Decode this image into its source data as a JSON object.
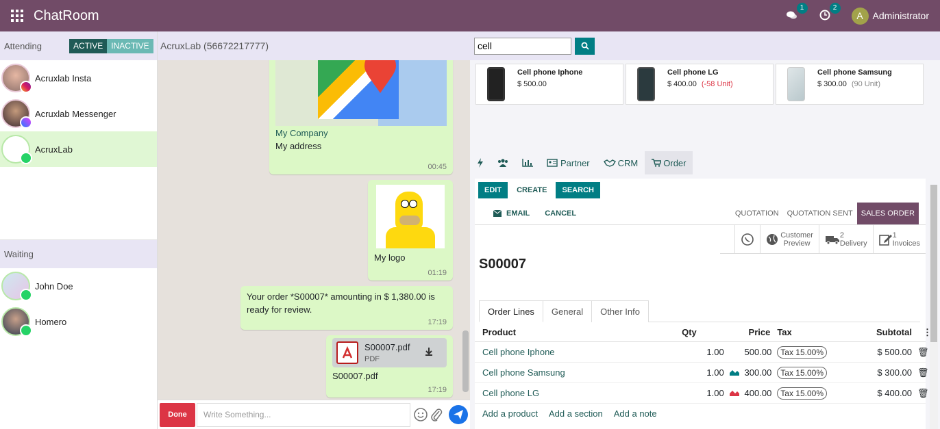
{
  "app": {
    "title": "ChatRoom",
    "user": "Administrator",
    "user_initial": "A",
    "badges": {
      "messages": "1",
      "activities": "2"
    }
  },
  "left": {
    "attending_label": "Attending",
    "toggle": {
      "active": "ACTIVE",
      "inactive": "INACTIVE"
    },
    "conversations": [
      {
        "name": "Acruxlab Insta",
        "channel": "instagram-icon"
      },
      {
        "name": "Acruxlab Messenger",
        "channel": "messenger-icon"
      },
      {
        "name": "AcruxLab",
        "channel": "whatsapp-icon"
      }
    ],
    "waiting_label": "Waiting",
    "waiting": [
      {
        "name": "John Doe",
        "channel": "whatsapp-icon"
      },
      {
        "name": "Homero",
        "channel": "whatsapp-icon"
      }
    ]
  },
  "chat": {
    "header": "AcruxLab (56672217777)",
    "messages": [
      {
        "link": "My Company",
        "text": "My address",
        "time": "00:45"
      },
      {
        "text": "My logo",
        "time": "01:19"
      },
      {
        "text": "Your order *S00007* amounting in $ 1,380.00 is ready for review.",
        "time": "17:19"
      },
      {
        "file_name": "S00007.pdf",
        "file_type": "PDF",
        "text": "S00007.pdf",
        "time": "17:19"
      }
    ],
    "done_label": "Done",
    "input_placeholder": "Write Something..."
  },
  "right": {
    "search_value": "cell",
    "products": [
      {
        "name": "Cell phone Iphone",
        "price": "$ 500.00",
        "stock": ""
      },
      {
        "name": "Cell phone LG",
        "price": "$ 400.00",
        "stock": "(-58 Unit)"
      },
      {
        "name": "Cell phone Samsung",
        "price": "$ 300.00",
        "stock": "(90 Unit)"
      }
    ],
    "tabs": {
      "partner": "Partner",
      "crm": "CRM",
      "order": "Order"
    },
    "buttons": {
      "edit": "EDIT",
      "create": "CREATE",
      "search": "SEARCH",
      "email": "EMAIL",
      "cancel": "CANCEL"
    },
    "stages": [
      "QUOTATION",
      "QUOTATION SENT",
      "SALES ORDER"
    ],
    "smart": {
      "customer_preview_1": "Customer",
      "customer_preview_2": "Preview",
      "delivery_count": "2",
      "delivery": "Delivery",
      "invoices_count": "1",
      "invoices": "Invoices"
    },
    "order_name": "S00007",
    "notebook": [
      "Order Lines",
      "General",
      "Other Info"
    ],
    "columns": {
      "product": "Product",
      "qty": "Qty",
      "price": "Price",
      "tax": "Tax",
      "subtotal": "Subtotal"
    },
    "lines": [
      {
        "product": "Cell phone Iphone",
        "qty": "1.00",
        "price": "500.00",
        "tax": "Tax 15.00%",
        "subtotal": "$ 500.00",
        "forecast": "none"
      },
      {
        "product": "Cell phone Samsung",
        "qty": "1.00",
        "price": "300.00",
        "tax": "Tax 15.00%",
        "subtotal": "$ 300.00",
        "forecast": "available"
      },
      {
        "product": "Cell phone LG",
        "qty": "1.00",
        "price": "400.00",
        "tax": "Tax 15.00%",
        "subtotal": "$ 400.00",
        "forecast": "shortage"
      }
    ],
    "add": {
      "product": "Add a product",
      "section": "Add a section",
      "note": "Add a note"
    }
  },
  "colors": {
    "brand": "#714b67",
    "accent": "#017e84",
    "bubble": "#dcf8c6",
    "danger": "#dc3545"
  }
}
